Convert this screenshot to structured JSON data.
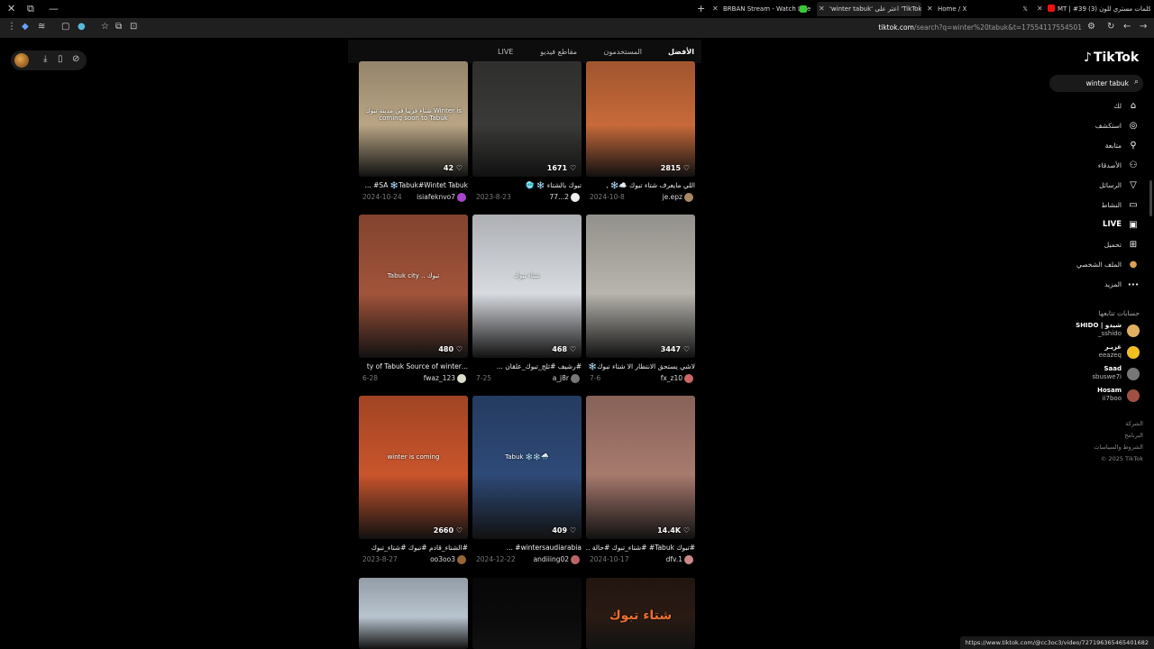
{
  "browser": {
    "tabs": [
      {
        "label": "MT | #39 (3) كلمات مستري للون",
        "active": false
      },
      {
        "label": "Home / X",
        "active": false
      },
      {
        "label": "'winter tabuk' اعثر على 'TikTok",
        "active": true
      },
      {
        "label": "BRBAN Stream - Watch Live o",
        "active": false
      }
    ],
    "url_host": "tiktok.com",
    "url_path": "/search?q=winter%20tabuk&t=17554117554501"
  },
  "search_tabs": [
    "الأفضل",
    "المستخدمون",
    "مقاطع فيديو",
    "LIVE"
  ],
  "videos": [
    {
      "likes": "2815",
      "caption": "اللي مايعرف شتاء تبوك ☁️❄️ ,",
      "date": "2024-10-8",
      "user": "je.epz",
      "color": "#c86a3a",
      "overlay": ""
    },
    {
      "likes": "1671",
      "caption": "تبوك بالشتاء ❄️ 🥶",
      "date": "2023-8-23",
      "user": "77...2",
      "color": "#3a3a38",
      "overlay": ""
    },
    {
      "likes": "42",
      "caption": "SA ❄️Tabuk#Wintet Tabuk# ...",
      "date": "2024-10-24",
      "user": "isiafeknvo7",
      "color": "#b9a585",
      "overlay": "شتاء قريبا في مدينة تبوك Winter is coming soon to Tabuk"
    },
    {
      "likes": "3447",
      "caption": "لاشي يستحق الانتظار الا شتاء تبوك❄️ ...",
      "date": "7-6",
      "user": "fx_z10",
      "color": "#b8b5ae",
      "overlay": ""
    },
    {
      "likes": "468",
      "caption": "#رشيف #ثلج_تبوك_علقان ...",
      "date": "7-25",
      "user": "a_j8r",
      "color": "#d8dbe0",
      "overlay": "شتاء تبوك"
    },
    {
      "likes": "480",
      "caption": "...ty of Tabuk Source of winter",
      "date": "6-28",
      "user": "fwaz_123",
      "color": "#a2543a",
      "overlay": "Tabuk city .. تبوك"
    },
    {
      "likes": "14.4K",
      "caption": "#تبوك Tabuk# #شتاء_تبوك #حالة ...",
      "date": "2024-10-17",
      "user": "dfv.1",
      "color": "#a87a6e",
      "overlay": ""
    },
    {
      "likes": "409",
      "caption": "wintersaudiarabia# ...",
      "date": "2024-12-22",
      "user": "andiiing02",
      "color": "#2e4a78",
      "overlay": "Tabuk ❄️❄️🌧️"
    },
    {
      "likes": "2660",
      "caption": "#الشتاء_قادم #تبوك #شتاء_تبوك",
      "date": "2023-8-27",
      "user": "oo3oo3",
      "color": "#c9552c",
      "overlay": "winter is coming"
    },
    {
      "likes": "",
      "caption": "",
      "date": "",
      "user": "",
      "color": "#2a1a14",
      "overlay": "شتاء تبوك"
    },
    {
      "likes": "",
      "caption": "",
      "date": "",
      "user": "",
      "color": "#0a0a0a",
      "overlay": ""
    },
    {
      "likes": "",
      "caption": "",
      "date": "",
      "user": "",
      "color": "#b8c4cf",
      "overlay": ""
    }
  ],
  "sidebar": {
    "logo": "TikTok",
    "search_value": "winter tabuk",
    "nav": [
      {
        "label": "لك",
        "icon": "home-icon",
        "glyph": "⌂"
      },
      {
        "label": "استكشف",
        "icon": "compass-icon",
        "glyph": "◎"
      },
      {
        "label": "متابعة",
        "icon": "user-plus-icon",
        "glyph": "⚲"
      },
      {
        "label": "الأصدقاء",
        "icon": "friends-icon",
        "glyph": "⚇"
      },
      {
        "label": "الرسائل",
        "icon": "send-icon",
        "glyph": "▽"
      },
      {
        "label": "النشاط",
        "icon": "inbox-icon",
        "glyph": "▭"
      },
      {
        "label": "LIVE",
        "icon": "live-icon",
        "glyph": "▣"
      },
      {
        "label": "تحميل",
        "icon": "upload-icon",
        "glyph": "⊞"
      },
      {
        "label": "الملف الشخصي",
        "icon": "profile-avatar-icon",
        "glyph": "●"
      },
      {
        "label": "المزيد",
        "icon": "more-icon",
        "glyph": "•••"
      }
    ],
    "following_title": "حسابات تتابعها",
    "accounts": [
      {
        "name": "SHIDO | شيدو",
        "handle": "_sshido",
        "color": "#e0b060"
      },
      {
        "name": "غزيـر",
        "handle": "eeazeq",
        "color": "#f0c020"
      },
      {
        "name": "Saad",
        "handle": "sbuswe7i",
        "color": "#777"
      },
      {
        "name": "Hosam",
        "handle": "ii7boo",
        "color": "#a05040"
      }
    ],
    "footer": [
      "الشركة",
      "البرنامج",
      "الشروط والسياسات",
      "© 2025 TikTok"
    ]
  },
  "status_url": "https://www.tiktok.com/@cc3oc3/video/727196365465401682"
}
